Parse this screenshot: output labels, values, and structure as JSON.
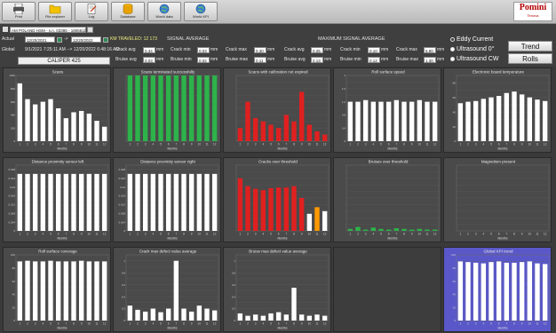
{
  "toolbar": {
    "buttons": [
      {
        "name": "print-button",
        "icon": "printer-icon",
        "label": "Print"
      },
      {
        "name": "file-explorer-button",
        "icon": "folder-icon",
        "label": "File explorer"
      },
      {
        "name": "log-button",
        "icon": "log-icon",
        "label": "Log"
      },
      {
        "name": "database-button",
        "icon": "database-icon",
        "label": "Database"
      },
      {
        "name": "world-data-button",
        "icon": "globe-icon",
        "label": "World data"
      },
      {
        "name": "world-kpi-button",
        "icon": "globe-icon",
        "label": "World KPI"
      }
    ],
    "logo_main": "Pomini",
    "logo_sub": "Tenova"
  },
  "info": {
    "mill_name": "AM POLAND HSM - s.n. 03386 - 1806511",
    "actual_label": "Actual",
    "global_label": "Global",
    "actual_from": "12/20/2021",
    "arrow": "->",
    "actual_to": "12/20/2022",
    "km_traveled": "KM TRAVELED: 12 173",
    "global_range": "9/1/2021 7:25:11 AM    -->  12/20/2022 6:48:16 AM",
    "caliper": "CALIPER 425",
    "signal_average_title": "SIGNAL AVERAGE",
    "maximum_signal_average_title": "MAXIMUM SIGNAL AVERAGE",
    "unit": "mm",
    "signal_average": {
      "crack_avg_label": "Crack avg",
      "crack_avg": "0.34",
      "crack_min_label": "Crack min",
      "crack_min": "0.03",
      "crack_max_label": "Crack max",
      "crack_max": "0.30",
      "bruise_avg_label": "Bruise avg",
      "bruise_avg": "0.03",
      "bruise_min_label": "Bruise min",
      "bruise_min": "0.02",
      "bruise_max_label": "Bruise max",
      "bruise_max": "0.11"
    },
    "maximum_signal_average": {
      "crack_avg_label": "Crack avg",
      "crack_avg": "0.25",
      "crack_min_label": "Crack min",
      "crack_min": "0.10",
      "crack_max_label": "Crack max",
      "crack_max": "5.90",
      "bruise_avg_label": "Bruise avg",
      "bruise_avg": "0.13",
      "bruise_min_label": "Bruise min",
      "bruise_min": "0.12",
      "bruise_max_label": "Bruise max",
      "bruise_max": "1.30"
    }
  },
  "sensor_options": [
    {
      "label": "Eddy Current",
      "selected": false
    },
    {
      "label": "Ultrasound 0°",
      "selected": true
    },
    {
      "label": "Ultrasound CW",
      "selected": true
    }
  ],
  "side_buttons": {
    "trend": "Trend",
    "rolls": "Rolls"
  },
  "colors": {
    "white_bar": "#ffffff",
    "green_bar": "#2db34a",
    "red_bar": "#e02020",
    "orange_bar": "#ff9900",
    "blue_panel": "#5a58c8"
  },
  "chart_data": [
    {
      "type": "bar",
      "title": "Scans",
      "xlabel": "Months",
      "categories": [
        "1",
        "2",
        "3",
        "4",
        "5",
        "6",
        "7",
        "8",
        "9",
        "10",
        "11",
        "12"
      ],
      "values": [
        880,
        640,
        560,
        600,
        640,
        500,
        350,
        440,
        460,
        420,
        310,
        220
      ],
      "ylim": [
        0,
        1000
      ],
      "yticks": [
        "0",
        "100",
        "200",
        "300",
        "400",
        "500",
        "600",
        "700",
        "800",
        "900",
        "1000"
      ],
      "color": "#ffffff"
    },
    {
      "type": "bar",
      "title": "Scans terminated successfully",
      "xlabel": "Months",
      "categories": [
        "1",
        "2",
        "3",
        "4",
        "5",
        "6",
        "7",
        "8",
        "9",
        "10",
        "11",
        "12"
      ],
      "values": [
        100,
        100,
        100,
        100,
        100,
        100,
        100,
        100,
        100,
        100,
        100,
        100
      ],
      "ylim": [
        0,
        100
      ],
      "yticks": [],
      "color": "#2db34a"
    },
    {
      "type": "bar",
      "title": "Scans with calibration not expired",
      "xlabel": "Months",
      "categories": [
        "1",
        "2",
        "3",
        "4",
        "5",
        "6",
        "7",
        "8",
        "9",
        "10",
        "11",
        "12"
      ],
      "values": [
        20,
        60,
        35,
        30,
        25,
        20,
        40,
        30,
        75,
        25,
        15,
        10
      ],
      "ylim": [
        0,
        100
      ],
      "yticks": [],
      "color": "#e02020"
    },
    {
      "type": "bar",
      "title": "Roll surface speed",
      "xlabel": "Months",
      "categories": [
        "1",
        "2",
        "3",
        "4",
        "5",
        "6",
        "7",
        "8",
        "9",
        "10",
        "11",
        "12"
      ],
      "values": [
        1.2,
        1.2,
        1.25,
        1.2,
        1.2,
        1.2,
        1.25,
        1.2,
        1.2,
        1.25,
        1.2,
        1.2
      ],
      "ylim": [
        0,
        2
      ],
      "yticks": [
        "0",
        "0.2",
        "0.4",
        "0.6",
        "0.8",
        "1",
        "1.2",
        "1.4",
        "1.6",
        "1.8",
        "2"
      ],
      "color": "#ffffff"
    },
    {
      "type": "bar",
      "title": "Electronic board temperature",
      "xlabel": "Months",
      "categories": [
        "1",
        "2",
        "3",
        "4",
        "5",
        "6",
        "7",
        "8",
        "9",
        "10",
        "11",
        "12"
      ],
      "values": [
        52,
        54,
        55,
        58,
        60,
        62,
        66,
        68,
        64,
        60,
        57,
        55
      ],
      "ylim": [
        0,
        90
      ],
      "yticks": [
        "0",
        "10",
        "20",
        "30",
        "40",
        "50",
        "60",
        "70",
        "80",
        "90"
      ],
      "color": "#ffffff"
    },
    {
      "type": "bar",
      "title": "Distance proximity sensor left",
      "xlabel": "Months",
      "categories": [
        "1",
        "2",
        "3",
        "4",
        "5",
        "6",
        "7",
        "8",
        "9",
        "10",
        "11",
        "12"
      ],
      "values": [
        0.026,
        0.026,
        0.026,
        0.026,
        0.026,
        0.026,
        0.026,
        0.026,
        0.026,
        0.026,
        0.026,
        0.026
      ],
      "ylim": [
        0,
        0.03
      ],
      "yticks": [
        "0",
        "0.002",
        "0.004",
        "0.006",
        "0.008",
        "0.01",
        "0.012",
        "0.014",
        "0.016",
        "0.018",
        "0.02",
        "0.022",
        "0.024",
        "0.026",
        "0.028",
        "0.03"
      ],
      "color": "#ffffff"
    },
    {
      "type": "bar",
      "title": "Distance proximity sensor right",
      "xlabel": "Months",
      "categories": [
        "1",
        "2",
        "3",
        "4",
        "5",
        "6",
        "7",
        "8",
        "9",
        "10",
        "11",
        "12"
      ],
      "values": [
        0.026,
        0.026,
        0.026,
        0.026,
        0.026,
        0.026,
        0.026,
        0.026,
        0.026,
        0.026,
        0.026,
        0.026
      ],
      "ylim": [
        0,
        0.03
      ],
      "yticks": [
        "0",
        "0.002",
        "0.004",
        "0.006",
        "0.008",
        "0.01",
        "0.012",
        "0.014",
        "0.016",
        "0.018",
        "0.02",
        "0.022",
        "0.024",
        "0.026",
        "0.028",
        "0.03"
      ],
      "color": "#ffffff"
    },
    {
      "type": "bar",
      "title": "Cracks over threshold",
      "xlabel": "Months",
      "categories": [
        "1",
        "2",
        "3",
        "4",
        "5",
        "6",
        "7",
        "8",
        "9",
        "10",
        "11",
        "12"
      ],
      "values": [
        80,
        68,
        64,
        62,
        65,
        66,
        66,
        68,
        50,
        26,
        36,
        30
      ],
      "colors": [
        "#e02020",
        "#e02020",
        "#e02020",
        "#e02020",
        "#e02020",
        "#e02020",
        "#e02020",
        "#e02020",
        "#e02020",
        "#ffffff",
        "#ff9900",
        "#ffffff"
      ],
      "ylim": [
        0,
        100
      ],
      "yticks": [],
      "color": "#e02020"
    },
    {
      "type": "bar",
      "title": "Bruises over threshold",
      "xlabel": "Months",
      "categories": [
        "1",
        "2",
        "3",
        "4",
        "5",
        "6",
        "7",
        "8",
        "9",
        "10",
        "11",
        "12"
      ],
      "values": [
        3,
        6,
        2,
        5,
        3,
        2,
        4,
        3,
        2,
        3,
        2,
        2
      ],
      "ylim": [
        0,
        100
      ],
      "yticks": [],
      "color": "#2db34a"
    },
    {
      "type": "bar",
      "title": "Magnetism present",
      "xlabel": "Months",
      "categories": [
        "1",
        "2",
        "3",
        "4",
        "5",
        "6",
        "7",
        "8",
        "9",
        "10",
        "11",
        "12"
      ],
      "values": [
        0,
        0,
        0,
        0,
        0,
        0,
        0,
        0,
        0,
        0,
        0,
        0
      ],
      "ylim": [
        0,
        100
      ],
      "yticks": [],
      "color": "#ffffff"
    },
    {
      "type": "bar",
      "title": "Roll surface coverage",
      "xlabel": "Months",
      "categories": [
        "1",
        "2",
        "3",
        "4",
        "5",
        "6",
        "7",
        "8",
        "9",
        "10",
        "11",
        "12"
      ],
      "values": [
        90,
        91,
        90,
        90,
        91,
        90,
        90,
        90,
        91,
        90,
        90,
        90
      ],
      "ylim": [
        0,
        100
      ],
      "yticks": [
        "0",
        "10",
        "20",
        "30",
        "40",
        "50",
        "60",
        "70",
        "80",
        "90",
        "100"
      ],
      "color": "#ffffff"
    },
    {
      "type": "bar",
      "title": "Crack max defect value average",
      "xlabel": "Months",
      "categories": [
        "1",
        "2",
        "3",
        "4",
        "5",
        "6",
        "7",
        "8",
        "9",
        "10",
        "11",
        "12"
      ],
      "values": [
        0.25,
        0.18,
        0.15,
        0.2,
        0.14,
        0.2,
        1.0,
        0.2,
        0.15,
        0.25,
        0.2,
        0.17
      ],
      "ylim": [
        0,
        1.1
      ],
      "yticks": [
        "0",
        "0.1",
        "0.2",
        "0.3",
        "0.4",
        "0.5",
        "0.6",
        "0.7",
        "0.8",
        "0.9",
        "1",
        "1.1"
      ],
      "color": "#ffffff"
    },
    {
      "type": "bar",
      "title": "Bruise max defect value average",
      "xlabel": "Months",
      "categories": [
        "1",
        "2",
        "3",
        "4",
        "5",
        "6",
        "7",
        "8",
        "9",
        "10",
        "11",
        "12"
      ],
      "values": [
        0.12,
        0.08,
        0.1,
        0.08,
        0.12,
        0.14,
        0.1,
        0.55,
        0.1,
        0.08,
        0.1,
        0.08
      ],
      "ylim": [
        0,
        1.1
      ],
      "yticks": [
        "0",
        "0.1",
        "0.2",
        "0.3",
        "0.4",
        "0.5",
        "0.6",
        "0.7",
        "0.8",
        "0.9",
        "1",
        "1.1"
      ],
      "color": "#ffffff"
    },
    {
      "type": "bar",
      "title": "Global KPI trend",
      "xlabel": "Months",
      "categories": [
        "1",
        "2",
        "3",
        "4",
        "5",
        "6",
        "7",
        "8",
        "9",
        "10",
        "11",
        "12"
      ],
      "values": [
        90,
        89,
        88,
        87,
        89,
        90,
        88,
        88,
        89,
        90,
        87,
        86
      ],
      "ylim": [
        0,
        100
      ],
      "yticks": [
        "0",
        "10",
        "20",
        "30",
        "40",
        "50",
        "60",
        "70",
        "80",
        "90",
        "100"
      ],
      "color": "#ffffff",
      "background": "#5a58c8"
    }
  ]
}
